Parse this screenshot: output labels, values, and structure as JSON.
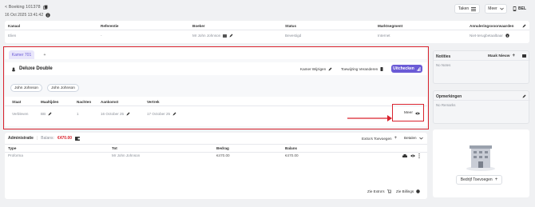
{
  "header": {
    "back_label": "< Boeking 101378",
    "datetime": "16 Oct 2025 13:41:42",
    "tasks_label": "Taken",
    "more_label": "Meer",
    "call_label": "BEL"
  },
  "booking_table": {
    "columns": [
      "Kanaal",
      "Referentie",
      "Boeker",
      "Status",
      "Marktsegment",
      "Annuleringsvoorwaarden"
    ],
    "row": [
      "Elien",
      "-",
      "Mr John Johnson",
      "Bevestigd",
      "Internet",
      "Niet-terugbetaalbaar"
    ]
  },
  "room_panel": {
    "tab_label": "Kamer 701",
    "add_tab": "+",
    "room_type": "Deluxe Double",
    "change_room": "Kamer Wijzigen",
    "change_assignment": "Toewijzing Veranderen",
    "checkout": "Uitchecken",
    "guests": [
      "John Johnson",
      "John Johnson"
    ],
    "columns": [
      "Staat",
      "Maaltijden",
      "Nachten",
      "Aankomst",
      "Vertrek"
    ],
    "row": [
      "Verbleven",
      "BB",
      "1",
      "16 October 25",
      "17 October 25"
    ],
    "more_label": "Meer"
  },
  "admin": {
    "title": "Administratie",
    "balance_label": "Balans:",
    "balance_value": "€470.00",
    "extras_label": "Extra's Toevoegen",
    "pay_label": "Betalen",
    "columns": [
      "Type",
      "Tot",
      "Bedrag",
      "Balans"
    ],
    "row": [
      "Proforma",
      "Mr John Johnson",
      "€470.00",
      "€470.00"
    ],
    "see_extras": "Zie Extra's",
    "see_invoices": "Zie Billings"
  },
  "notes": {
    "title": "Notities",
    "create_label": "Maak Nieuw",
    "empty": "No Notes"
  },
  "remarks": {
    "title": "Opmerkingen",
    "empty": "No Remarks"
  },
  "company": {
    "add_label": "Bedrijf Toevoegen"
  },
  "colors": {
    "accent": "#6b5bd6",
    "red": "#d9232e",
    "balance": "#d9232e"
  }
}
